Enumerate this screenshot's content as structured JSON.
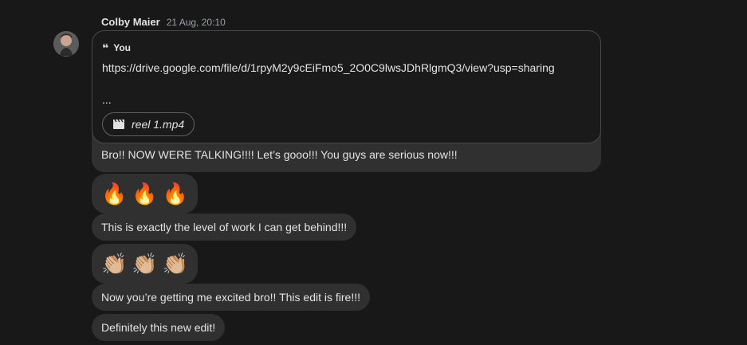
{
  "thread": {
    "sender_name": "Colby Maier",
    "timestamp": "21 Aug, 20:10"
  },
  "quote": {
    "icon": "quote-icon",
    "author": "You",
    "link": "https://drive.google.com/file/d/1rpyM2y9cEiFmo5_2O0C9lwsJDhRlgmQ3/view?usp=sharing",
    "ellipsis": "...",
    "file_icon": "clapperboard-icon",
    "file_name": "reel 1.mp4",
    "reply_text": "Bro!! NOW WERE TALKING!!!! Let’s gooo!!! You guys are serious now!!!"
  },
  "messages": {
    "m2": "🔥🔥🔥",
    "m3": "This is exactly the level of work I can get behind!!!",
    "m4": "👏🏼👏🏼👏🏼",
    "m5": "Now you’re getting me excited bro!! This edit is fire!!!",
    "m6": "Definitely this new edit!"
  },
  "emoji_sets": {
    "m2": [
      "🔥",
      "🔥",
      "🔥"
    ],
    "m4": [
      "👏🏼",
      "👏🏼",
      "👏🏼"
    ]
  }
}
